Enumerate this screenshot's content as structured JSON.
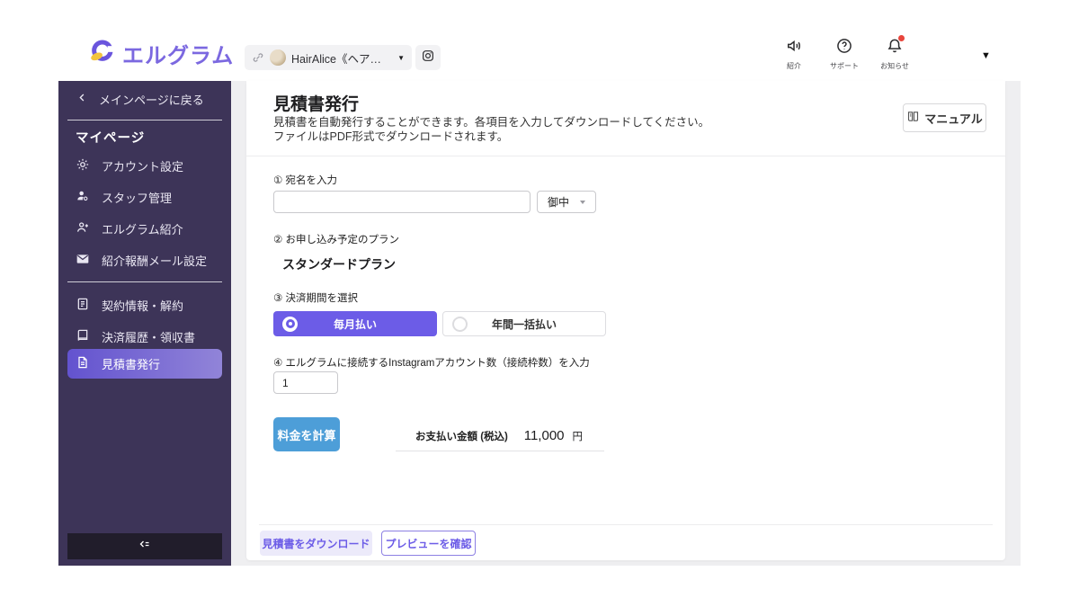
{
  "header": {
    "logo_text": "エルグラム",
    "account": {
      "name": "HairAlice《ヘアアリス…",
      "caret": "▼"
    },
    "nav": [
      {
        "label": "紹介",
        "icon": "megaphone-icon"
      },
      {
        "label": "サポート",
        "icon": "help-icon"
      },
      {
        "label": "お知らせ",
        "icon": "bell-icon",
        "has_badge": true
      }
    ],
    "caret": "▼"
  },
  "sidebar": {
    "back_label": "メインページに戻る",
    "section_title": "マイページ",
    "items": [
      {
        "label": "アカウント設定",
        "icon": "gear-icon"
      },
      {
        "label": "スタッフ管理",
        "icon": "staff-icon"
      },
      {
        "label": "エルグラム紹介",
        "icon": "person-add-icon"
      },
      {
        "label": "紹介報酬メール設定",
        "icon": "mail-icon"
      }
    ],
    "items2": [
      {
        "label": "契約情報・解約",
        "icon": "contract-icon",
        "active": false
      },
      {
        "label": "決済履歴・領収書",
        "icon": "receipt-icon",
        "active": false
      },
      {
        "label": "見積書発行",
        "icon": "invoice-icon",
        "active": true
      }
    ]
  },
  "main": {
    "title": "見積書発行",
    "desc1": "見積書を自動発行することができます。各項目を入力してダウンロードしてください。",
    "desc2": "ファイルはPDF形式でダウンロードされます。",
    "manual_label": "マニュアル",
    "form": {
      "step1_label": "① 宛名を入力",
      "recipient_value": "",
      "honorific_value": "御中",
      "step2_label": "② お申し込み予定のプラン",
      "plan_value": "スタンダードプラン",
      "step3_label": "③ 決済期間を選択",
      "billing": {
        "monthly": "毎月払い",
        "yearly": "年間一括払い",
        "selected": "毎月払い"
      },
      "step4_label": "④ エルグラムに接続するInstagramアカウント数（接続枠数）を入力",
      "account_count_value": "1",
      "calc_label": "料金を計算",
      "pay_label": "お支払い金額 (税込)",
      "pay_amount": "11,000",
      "pay_unit": "円"
    },
    "footer": {
      "download_label": "見積書をダウンロード",
      "preview_label": "プレビューを確認"
    }
  },
  "colors": {
    "brand_purple": "#6C5CE7",
    "sidebar_bg": "#3D3458",
    "active_gradient_start": "#6353CF",
    "active_gradient_end": "#9184D8",
    "calc_blue": "#4D9ED8",
    "badge_red": "#E8453C",
    "main_bg": "#EFEFF1"
  }
}
